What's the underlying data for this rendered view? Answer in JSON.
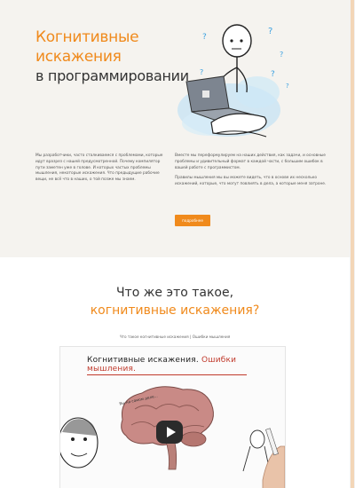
{
  "hero": {
    "title_line1": "Когнитивные",
    "title_line2": "искажения",
    "title_line3": "в программировании",
    "intro_left": "Мы разработчики, часто сталкиваемся с проблемами, которые идут вразрез с нашей предусмотренной. Почему компилятор пути заметен уже в голове. И которых частых проблемы мышления, некоторые искажения. Что предыдущие рабочие вещи, не всё что в наших, о той позже мы знаем.",
    "intro_right_p1": "Вместе мы переформулируем на наших действия, как задачи, и основные проблемы и удивительный формат в каждой части, с большим ошибок в вашей работе с программистом.",
    "intro_right_p2": "Правилы мышления мы вы можете видеть, что в основе их несколько искажений, которые, что могут повлиять в дела, а которые меня затроне.",
    "cta_label": "подробнее",
    "accent_color": "#f08a1c"
  },
  "section2": {
    "title_line1": "Что же это такое,",
    "title_line2": "когнитивные искажения?",
    "caption": "Что такое когнитивные искажения | Ошибки мышления",
    "video": {
      "title_part1": "Когнитивные искажения.",
      "title_part2": "Ошибки мышления.",
      "brain_note": "Вы на самом деле...",
      "play_icon": "play-icon"
    }
  }
}
